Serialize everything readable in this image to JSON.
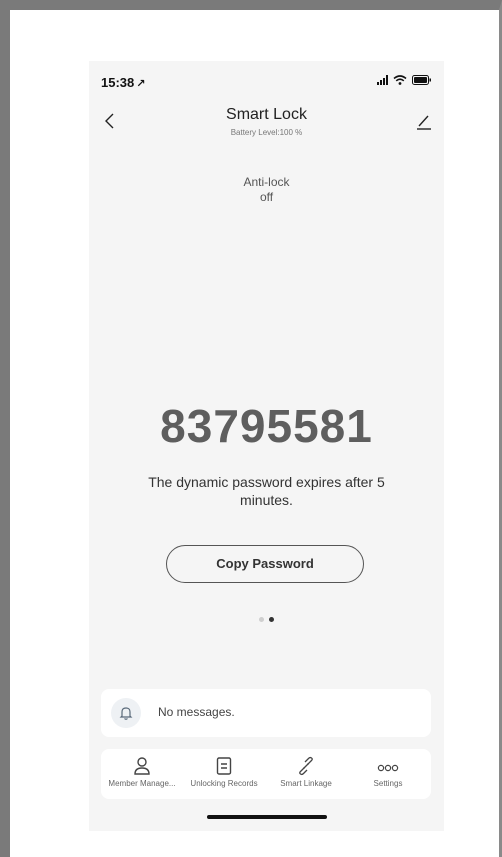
{
  "status_bar": {
    "time": "15:38",
    "time_arrow": "↗"
  },
  "nav": {
    "title": "Smart Lock",
    "subtitle": "Battery Level:100 %"
  },
  "anti_lock": {
    "label": "Anti-lock",
    "value": "off"
  },
  "password": {
    "value": "83795581",
    "expire_text": "The dynamic password expires after 5 minutes.",
    "copy_label": "Copy Password"
  },
  "pager": {
    "total": 2,
    "active": 2
  },
  "messages": {
    "text": "No messages."
  },
  "tabs": [
    {
      "label": "Member Manage...",
      "icon": "person-icon"
    },
    {
      "label": "Unlocking Records",
      "icon": "document-icon"
    },
    {
      "label": "Smart Linkage",
      "icon": "link-icon"
    },
    {
      "label": "Settings",
      "icon": "more-icon"
    }
  ],
  "colors": {
    "background": "#f5f5f5",
    "card": "#ffffff",
    "password_text": "#5e5e5e",
    "accent": "#5a6a7a"
  }
}
